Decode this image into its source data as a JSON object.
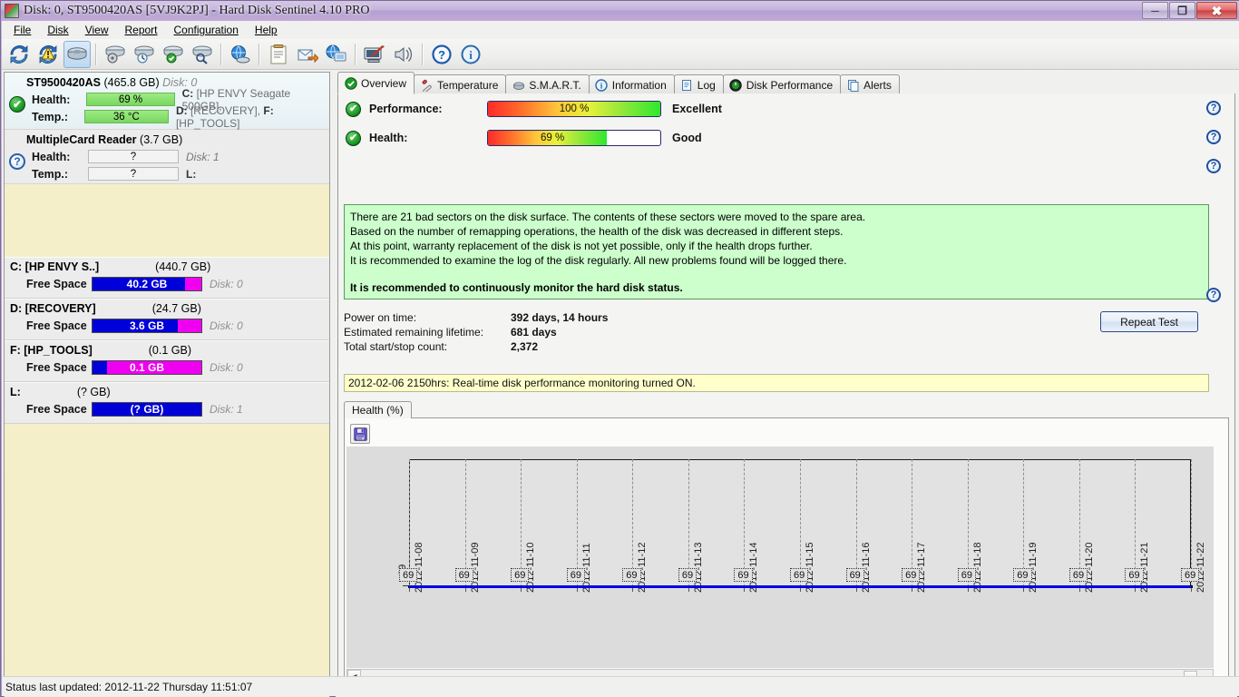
{
  "window": {
    "title": "Disk: 0, ST9500420AS [5VJ9K2PJ]  -  Hard Disk Sentinel 4.10 PRO",
    "minimize_label": "–",
    "maximize_label": "❐",
    "close_label": "✕"
  },
  "menu": {
    "items": [
      {
        "label": "File"
      },
      {
        "label": "Disk"
      },
      {
        "label": "View"
      },
      {
        "label": "Report"
      },
      {
        "label": "Configuration"
      },
      {
        "label": "Help"
      }
    ]
  },
  "toolbar": {
    "buttons": [
      {
        "name": "refresh-icon",
        "tip": "Refresh"
      },
      {
        "name": "warning-refresh-icon",
        "tip": "Problems"
      },
      {
        "name": "disk-overview-icon",
        "tip": "Disk Overview",
        "active": true
      },
      {
        "name": "disk-surface-test-icon",
        "tip": "Surface test"
      },
      {
        "name": "disk-performance-icon",
        "tip": "Performance"
      },
      {
        "name": "disk-verify-icon",
        "tip": "Verify"
      },
      {
        "name": "disk-search-icon",
        "tip": "Search"
      },
      {
        "name": "network-disk-icon",
        "tip": "Network"
      },
      {
        "name": "report-icon",
        "tip": "Report"
      },
      {
        "name": "send-report-icon",
        "tip": "Send report"
      },
      {
        "name": "remote-monitor-icon",
        "tip": "Remote monitoring"
      },
      {
        "name": "configuration-icon",
        "tip": "Configuration"
      },
      {
        "name": "alerts-sound-icon",
        "tip": "Alert sounds"
      },
      {
        "name": "help-icon",
        "tip": "Help"
      },
      {
        "name": "about-icon",
        "tip": "About"
      }
    ]
  },
  "sidebar": {
    "disks": [
      {
        "name": "ST9500420AS",
        "capacity": "(465.8 GB)",
        "disk_id": "Disk: 0",
        "status": "ok",
        "health_label": "Health:",
        "health_value": "69 %",
        "temp_label": "Temp.:",
        "temp_value": "36 °C",
        "letters_line1": "C: [HP ENVY Seagate 500GB],",
        "letters_line2": "D: [RECOVERY], F: [HP_TOOLS]",
        "selected": true
      },
      {
        "name": "MultipleCard  Reader",
        "capacity": "(3.7 GB)",
        "disk_id": "Disk: 1",
        "status": "unknown",
        "health_label": "Health:",
        "health_value": "?",
        "temp_label": "Temp.:",
        "temp_value": "?",
        "letters_line1": "Disk: 1",
        "letters_line2": "L:",
        "selected": false
      }
    ],
    "volumes": [
      {
        "letter": "C: [HP ENVY S..]",
        "capacity": "(440.7 GB)",
        "free_label": "Free Space",
        "free_value": "40.2 GB",
        "disk": "Disk: 0",
        "free_pct": 85,
        "bar_style": "blue-with-magenta-tail"
      },
      {
        "letter": "D: [RECOVERY]",
        "capacity": "(24.7 GB)",
        "free_label": "Free Space",
        "free_value": "3.6 GB",
        "disk": "Disk: 0",
        "free_pct": 78,
        "bar_style": "blue-with-magenta-tail"
      },
      {
        "letter": "F: [HP_TOOLS]",
        "capacity": "(0.1 GB)",
        "free_label": "Free Space",
        "free_value": "0.1 GB",
        "disk": "Disk: 0",
        "free_pct": 13,
        "bar_style": "blue-head-magenta-body"
      },
      {
        "letter": "L:",
        "capacity": "(? GB)",
        "free_label": "Free Space",
        "free_value": "(? GB)",
        "disk": "Disk: 1",
        "free_pct": 100,
        "bar_style": "blue-full"
      }
    ]
  },
  "tabs": [
    {
      "label": "Overview",
      "icon": "check-circle-icon",
      "active": true
    },
    {
      "label": "Temperature",
      "icon": "thermometer-icon",
      "active": false
    },
    {
      "label": "S.M.A.R.T.",
      "icon": "smart-chip-icon",
      "active": false
    },
    {
      "label": "Information",
      "icon": "info-circle-icon",
      "active": false
    },
    {
      "label": "Log",
      "icon": "document-icon",
      "active": false
    },
    {
      "label": "Disk Performance",
      "icon": "gauge-icon",
      "active": false
    },
    {
      "label": "Alerts",
      "icon": "copy-page-icon",
      "active": false
    }
  ],
  "overview": {
    "performance": {
      "label": "Performance:",
      "value": "100 %",
      "percent": 100,
      "status": "Excellent",
      "icon": "check-circle-icon"
    },
    "health": {
      "label": "Health:",
      "value": "69 %",
      "percent": 69,
      "status": "Good",
      "icon": "check-circle-icon"
    },
    "advice_lines": [
      "There are 21 bad sectors on the disk surface. The contents of these sectors were moved to the spare area.",
      "Based on the number of remapping operations, the health of the disk was decreased in different steps.",
      "At this point, warranty replacement of the disk is not yet possible, only if the health drops further.",
      "It is recommended to examine the log of the disk regularly. All new problems found will be logged there."
    ],
    "advice_bold": "It is recommended to continuously monitor the hard disk status.",
    "info": [
      {
        "key": "Power on time:",
        "value": "392 days, 14 hours"
      },
      {
        "key": "Estimated remaining lifetime:",
        "value": "681 days"
      },
      {
        "key": "Total start/stop count:",
        "value": "2,372"
      }
    ],
    "repeat_test_label": "Repeat Test",
    "log_line": "2012-02-06 2150hrs: Real-time disk performance monitoring turned ON.",
    "help_icons": [
      {
        "name": "help-performance-icon",
        "label": "?"
      },
      {
        "name": "help-health-icon",
        "label": "?"
      },
      {
        "name": "help-advice-icon",
        "label": "?"
      },
      {
        "name": "help-repeat-test-icon",
        "label": "?"
      }
    ]
  },
  "chart_panel": {
    "tab_label": "Health (%)",
    "save_icon": "save-floppy-icon",
    "scroll_left_label": "◀",
    "scroll_right_label": "▶"
  },
  "chart_data": {
    "type": "line",
    "title": "Health (%)",
    "xlabel": "",
    "ylabel": "69",
    "x": [
      "2012-11-08",
      "2012-11-09",
      "2012-11-10",
      "2012-11-11",
      "2012-11-12",
      "2012-11-13",
      "2012-11-14",
      "2012-11-15",
      "2012-11-16",
      "2012-11-17",
      "2012-11-18",
      "2012-11-19",
      "2012-11-20",
      "2012-11-21",
      "2012-11-22"
    ],
    "values": [
      69,
      69,
      69,
      69,
      69,
      69,
      69,
      69,
      69,
      69,
      69,
      69,
      69,
      69,
      69
    ],
    "point_labels": [
      "69",
      "69",
      "69",
      "69",
      "69",
      "69",
      "69",
      "69",
      "69",
      "69",
      "69",
      "69",
      "69",
      "69",
      "69"
    ],
    "series_color": "#0000e6",
    "ylim": [
      0,
      100
    ],
    "yticks": [
      "69"
    ],
    "grid": true,
    "legend": null
  },
  "statusbar": {
    "text": "Status last updated: 2012-11-22 Thursday 11:51:07"
  }
}
